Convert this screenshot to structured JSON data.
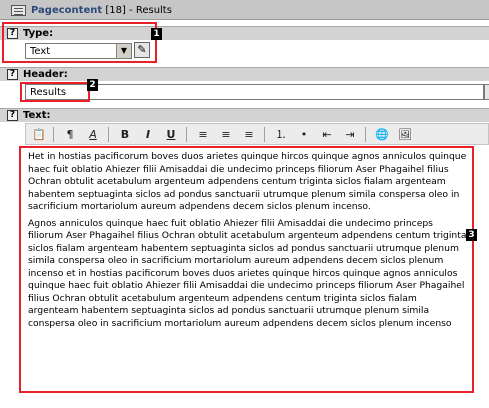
{
  "titlebar": {
    "app": "Pagecontent",
    "record": "[18]",
    "separator": " - ",
    "title": "Results"
  },
  "type_section": {
    "label": "Type:",
    "help": "?",
    "selected": "Text",
    "callout": "1"
  },
  "header_section": {
    "label": "Header:",
    "help": "?",
    "value": "Results",
    "callout": "2"
  },
  "text_section": {
    "label": "Text:",
    "help": "?",
    "callout": "3",
    "toolbar": [
      "paste-icon",
      "paragraph-style-icon",
      "text-style-icon",
      "bold-icon",
      "italic-icon",
      "underline-icon",
      "align-left-icon",
      "align-center-icon",
      "align-right-icon",
      "ordered-list-icon",
      "unordered-list-icon",
      "outdent-icon",
      "indent-icon",
      "insert-link-icon",
      "insert-image-icon"
    ],
    "paragraph1": "Het in hostias pacificorum boves duos arietes quinque hircos quinque agnos anniculos quinque haec fuit oblatio Ahiezer filii Amisaddai die undecimo princeps filiorum Aser Phagaihel filius Ochran obtulit acetabulum argenteum adpendens centum triginta siclos fialam argenteam habentem septuaginta siclos ad pondus sanctuarii utrumque plenum simila conspersa oleo in sacrificium mortariolum aureum adpendens decem siclos plenum incenso.",
    "paragraph2": "Agnos anniculos quinque haec fuit oblatio Ahiezer filii Amisaddai die undecimo princeps filiorum Aser Phagaihel filius Ochran obtulit acetabulum argenteum adpendens centum triginta siclos fialam argenteam habentem septuaginta siclos ad pondus sanctuarii utrumque plenum simila conspersa oleo in sacrificium mortariolum aureum adpendens decem siclos plenum incenso et in hostias pacificorum boves duos arietes quinque hircos quinque agnos anniculos quinque haec fuit oblatio Ahiezer filii Amisaddai die undecimo princeps filiorum Aser Phagaihel filius Ochran obtulit acetabulum argenteum adpendens centum triginta siclos fialam argenteam habentem septuaginta siclos ad pondus sanctuarii utrumque plenum simila conspersa oleo in sacrificium mortariolum aureum adpendens decem siclos plenum incenso"
  },
  "colors": {
    "highlight": "#e8202a",
    "callout_bg": "#000000",
    "section_bar": "#d3d3d3",
    "titlebar": "#c6c6c6"
  }
}
